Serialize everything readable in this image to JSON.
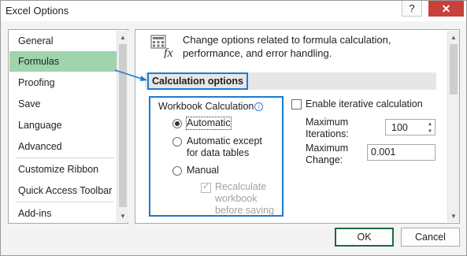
{
  "window": {
    "title": "Excel Options",
    "help_glyph": "?",
    "close_glyph": "✕"
  },
  "nav": {
    "items": [
      {
        "label": "General"
      },
      {
        "label": "Formulas",
        "selected": true
      },
      {
        "label": "Proofing"
      },
      {
        "label": "Save"
      },
      {
        "label": "Language"
      },
      {
        "label": "Advanced"
      },
      {
        "label": "Customize Ribbon"
      },
      {
        "label": "Quick Access Toolbar"
      },
      {
        "label": "Add-ins"
      }
    ],
    "selection_color": "#9fd4ad"
  },
  "content": {
    "icon": "calculator-fx-icon",
    "icon_text": "fx",
    "intro_line1": "Change options related to formula calculation,",
    "intro_line2": "performance, and error handling.",
    "section_title": "Calculation options",
    "workbook_calc": {
      "caption": "Workbook Calculation",
      "info_glyph": "i",
      "options": [
        {
          "label": "Automatic",
          "selected": true
        },
        {
          "label_line1": "Automatic except",
          "label_line2": "for data tables",
          "selected": false
        },
        {
          "label": "Manual",
          "selected": false
        }
      ],
      "recalc": {
        "line1": "Recalculate",
        "line2": "workbook",
        "line3": "before saving",
        "checked": true,
        "enabled": false
      }
    },
    "iterative": {
      "label": "Enable iterative calculation",
      "checked": false,
      "max_iterations_label1": "Maximum",
      "max_iterations_label2": "Iterations:",
      "max_iterations_value": "100",
      "max_change_label1": "Maximum",
      "max_change_label2": "Change:",
      "max_change_value": "0.001"
    }
  },
  "buttons": {
    "ok": "OK",
    "cancel": "Cancel"
  },
  "colors": {
    "accent_highlight": "#1c7bd0",
    "close_button": "#c7403a",
    "ok_border": "#1a6b3c"
  }
}
